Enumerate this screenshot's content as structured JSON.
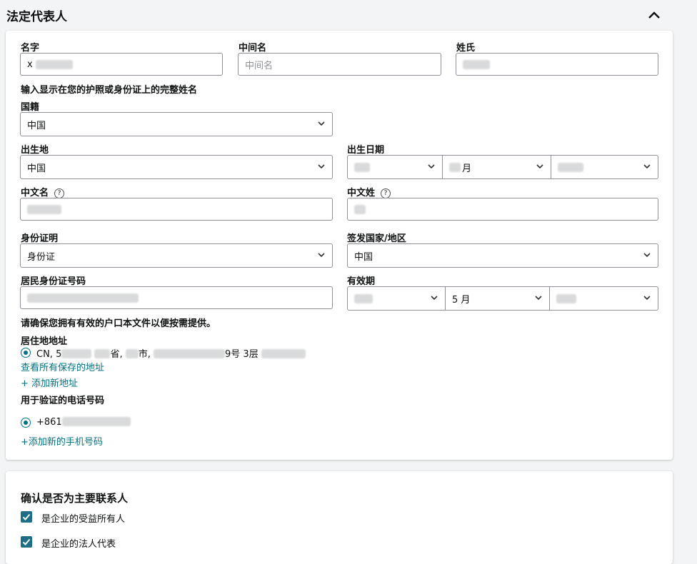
{
  "section": {
    "title": "法定代表人"
  },
  "name": {
    "first_label": "名字",
    "first_value": "x",
    "middle_label": "中间名",
    "middle_placeholder": "中间名",
    "last_label": "姓氏",
    "hint": "输入显示在您的护照或身份证上的完整姓名"
  },
  "nationality": {
    "label": "国籍",
    "value": "中国"
  },
  "birthplace": {
    "label": "出生地",
    "value": "中国"
  },
  "birthdate": {
    "label": "出生日期",
    "month_suffix": "月"
  },
  "chinese_first": {
    "label": "中文名"
  },
  "chinese_last": {
    "label": "中文姓"
  },
  "id_type": {
    "label": "身份证明",
    "value": "身份证"
  },
  "issuing_country": {
    "label": "签发国家/地区",
    "value": "中国"
  },
  "id_number": {
    "label": "居民身份证号码"
  },
  "expiry": {
    "label": "有效期",
    "month_value": "5 月"
  },
  "hukou_hint": "请确保您拥有有效的户口本文件以便按需提供。",
  "address": {
    "label": "居住地地址",
    "parts": [
      "CN, 5",
      "省, ",
      "市, ",
      "9号 3层"
    ],
    "view_link": "查看所有保存的地址",
    "add_link": "+ 添加新地址"
  },
  "phone": {
    "label": "用于验证的电话号码",
    "value": "+861",
    "add_link": "+添加新的手机号码"
  },
  "contact": {
    "title": "确认是否为主要联系人",
    "options": [
      "是企业的受益所有人",
      "是企业的法人代表"
    ]
  },
  "icons": [
    "chevron-up-icon",
    "chevron-down-icon",
    "help-icon",
    "radio-selected-icon",
    "checkbox-checked-icon"
  ],
  "colors": {
    "link": "#007185",
    "checkbox": "#1d6f85",
    "border": "#8d9096"
  }
}
